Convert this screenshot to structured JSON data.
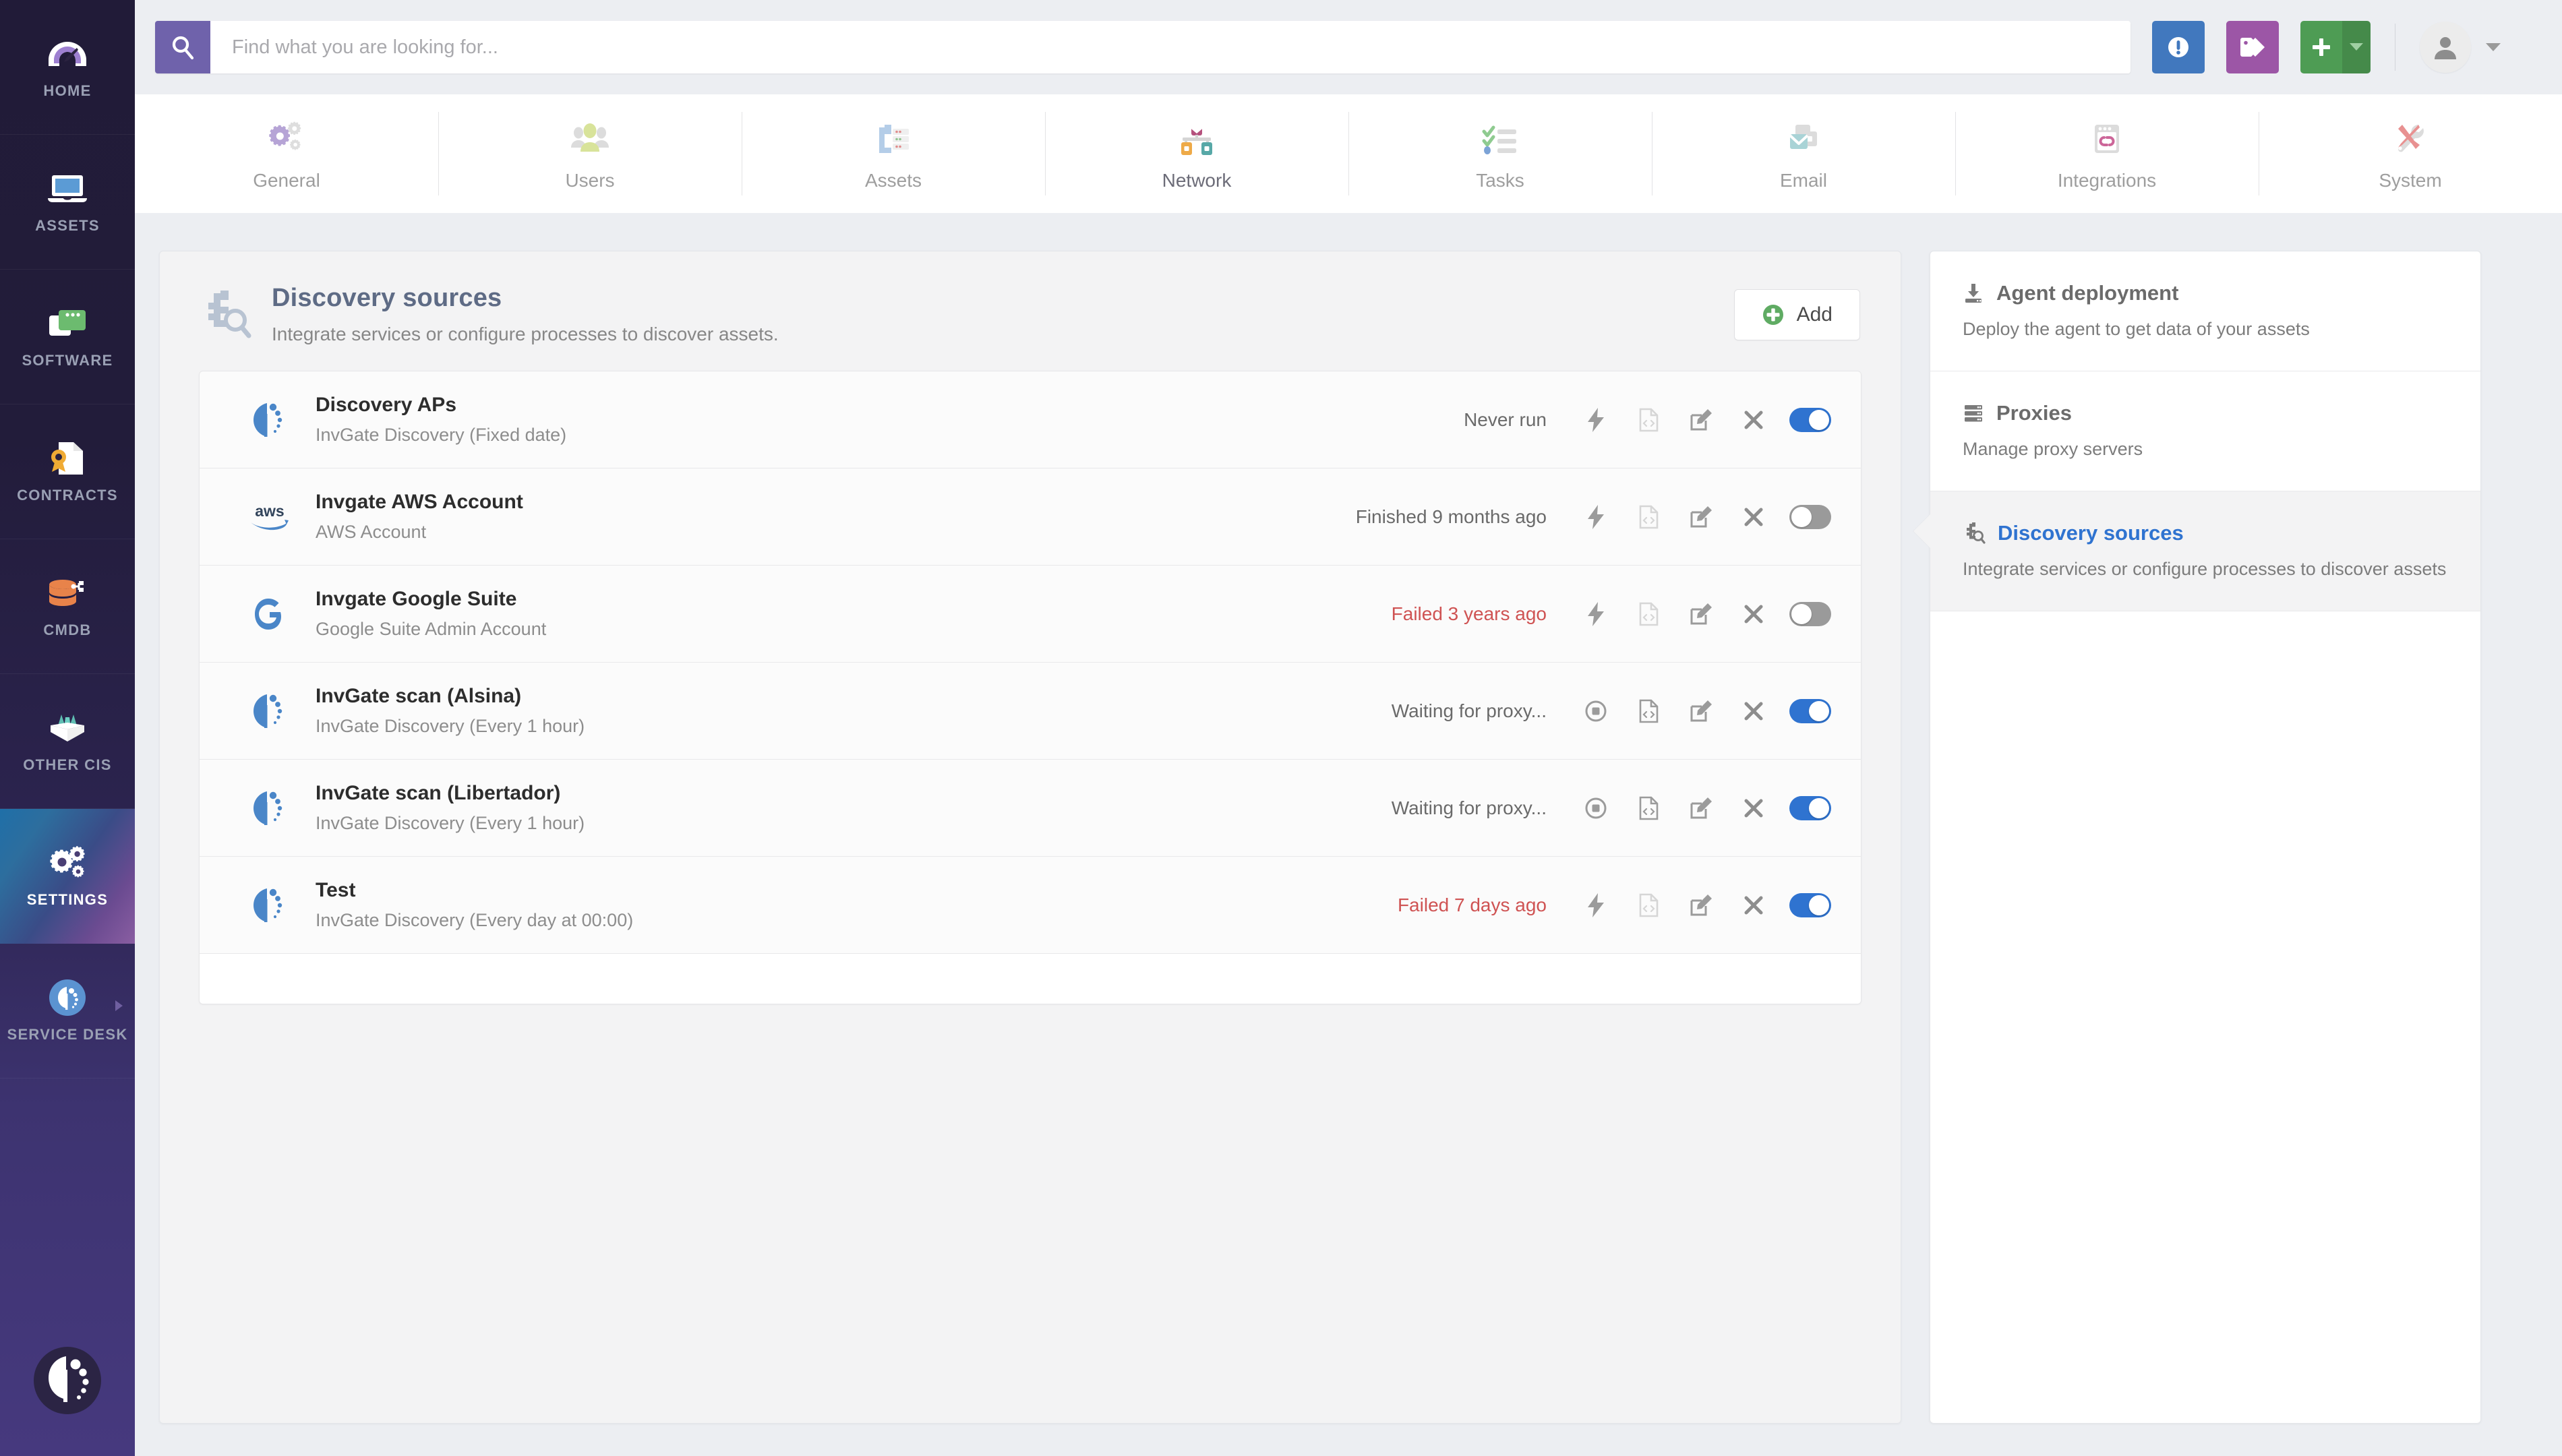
{
  "search": {
    "placeholder": "Find what you are looking for...",
    "value": "",
    "icon": "search-icon"
  },
  "topbar": {
    "alert_icon": "alert-circle-icon",
    "tag_icon": "tags-icon",
    "add_icon": "plus-icon",
    "add_caret_icon": "caret-down-icon",
    "avatar_icon": "user-avatar-icon",
    "avatar_caret_icon": "caret-down-icon"
  },
  "left_rail": {
    "items": [
      {
        "label": "HOME",
        "icon": "speedometer-icon",
        "active": false
      },
      {
        "label": "ASSETS",
        "icon": "laptop-icon",
        "active": false
      },
      {
        "label": "SOFTWARE",
        "icon": "windows-app-icon",
        "active": false
      },
      {
        "label": "CONTRACTS",
        "icon": "certificate-document-icon",
        "active": false
      },
      {
        "label": "CMDB",
        "icon": "database-node-icon",
        "active": false
      },
      {
        "label": "OTHER CIs",
        "icon": "open-box-icon",
        "active": false
      },
      {
        "label": "SETTINGS",
        "icon": "gears-icon",
        "active": true
      },
      {
        "label": "SERVICE DESK",
        "icon": "invgate-circle-icon",
        "active": false,
        "has_arrow": true
      }
    ],
    "logo_icon": "invgate-logo-icon"
  },
  "tabs": [
    {
      "label": "General",
      "icon": "gears-icon",
      "active": false
    },
    {
      "label": "Users",
      "icon": "people-icon",
      "active": false
    },
    {
      "label": "Assets",
      "icon": "assets-rack-icon",
      "active": false
    },
    {
      "label": "Network",
      "icon": "network-nodes-icon",
      "active": true
    },
    {
      "label": "Tasks",
      "icon": "checklist-icon",
      "active": false
    },
    {
      "label": "Email",
      "icon": "email-icon",
      "active": false
    },
    {
      "label": "Integrations",
      "icon": "integrations-icon",
      "active": false
    },
    {
      "label": "System",
      "icon": "tools-icon",
      "active": false
    }
  ],
  "main": {
    "header_icon": "discovery-source-icon",
    "title": "Discovery sources",
    "subtitle": "Integrate services or configure processes to discover assets.",
    "add_button": {
      "label": "Add",
      "icon": "plus-circle-icon"
    }
  },
  "sources": [
    {
      "logo": "invgate-discovery-icon",
      "name": "Discovery APs",
      "description": "InvGate Discovery (Fixed date)",
      "status": "Never run",
      "status_failed": false,
      "run_icon": "lightning-icon",
      "run_icon_variant": "lightning",
      "log_icon": "code-file-icon",
      "log_disabled": true,
      "edit_icon": "edit-pencil-icon",
      "delete_icon": "close-x-icon",
      "toggle": "on"
    },
    {
      "logo": "aws-logo-icon",
      "name": "Invgate AWS Account",
      "description": "AWS Account",
      "status": "Finished 9 months ago",
      "status_failed": false,
      "run_icon": "lightning-icon",
      "run_icon_variant": "lightning",
      "log_icon": "code-file-icon",
      "log_disabled": true,
      "edit_icon": "edit-pencil-icon",
      "delete_icon": "close-x-icon",
      "toggle": "off"
    },
    {
      "logo": "google-g-icon",
      "name": "Invgate Google Suite",
      "description": "Google Suite Admin Account",
      "status": "Failed 3 years ago",
      "status_failed": true,
      "run_icon": "lightning-icon",
      "run_icon_variant": "lightning",
      "log_icon": "code-file-icon",
      "log_disabled": true,
      "edit_icon": "edit-pencil-icon",
      "delete_icon": "close-x-icon",
      "toggle": "off"
    },
    {
      "logo": "invgate-discovery-icon",
      "name": "InvGate scan (Alsina)",
      "description": "InvGate Discovery (Every 1 hour)",
      "status": "Waiting for proxy...",
      "status_failed": false,
      "run_icon": "stop-circle-icon",
      "run_icon_variant": "stop",
      "log_icon": "code-file-icon",
      "log_disabled": false,
      "edit_icon": "edit-pencil-icon",
      "delete_icon": "close-x-icon",
      "toggle": "on"
    },
    {
      "logo": "invgate-discovery-icon",
      "name": "InvGate scan (Libertador)",
      "description": "InvGate Discovery (Every 1 hour)",
      "status": "Waiting for proxy...",
      "status_failed": false,
      "run_icon": "stop-circle-icon",
      "run_icon_variant": "stop",
      "log_icon": "code-file-icon",
      "log_disabled": false,
      "edit_icon": "edit-pencil-icon",
      "delete_icon": "close-x-icon",
      "toggle": "on"
    },
    {
      "logo": "invgate-discovery-icon",
      "name": "Test",
      "description": "InvGate Discovery (Every day at 00:00)",
      "status": "Failed 7 days ago",
      "status_failed": true,
      "run_icon": "lightning-icon",
      "run_icon_variant": "lightning",
      "log_icon": "code-file-icon",
      "log_disabled": true,
      "edit_icon": "edit-pencil-icon",
      "delete_icon": "close-x-icon",
      "toggle": "on"
    }
  ],
  "right_panel": [
    {
      "icon": "agent-download-icon",
      "title": "Agent deployment",
      "subtitle": "Deploy the agent to get data of your assets",
      "active": false
    },
    {
      "icon": "server-rack-icon",
      "title": "Proxies",
      "subtitle": "Manage proxy servers",
      "active": false
    },
    {
      "icon": "discovery-source-icon",
      "title": "Discovery sources",
      "subtitle": "Integrate services or configure processes to discover assets",
      "active": true
    }
  ],
  "colors": {
    "accent_purple": "#6f62ab",
    "link_blue": "#2f73d0",
    "failed_red": "#cf5353",
    "green": "#4e9c54",
    "rail_dark": "#211b38"
  }
}
